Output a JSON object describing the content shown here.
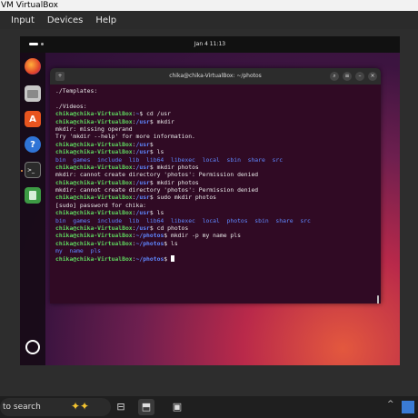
{
  "host": {
    "title": "VM VirtualBox",
    "menu": [
      "Input",
      "Devices",
      "Help"
    ]
  },
  "guest": {
    "clock": "Jan 4  11:13",
    "dock": [
      "firefox",
      "files",
      "app-center",
      "help",
      "terminal",
      "trash",
      "show-apps"
    ]
  },
  "terminal": {
    "title": "chika@chika-VirtualBox: ~/photos",
    "lines": [
      {
        "type": "out",
        "text": "./Templates:"
      },
      {
        "type": "out",
        "text": ""
      },
      {
        "type": "out",
        "text": "./Videos:"
      },
      {
        "type": "prompt",
        "path": "~",
        "cmd": " cd /usr"
      },
      {
        "type": "prompt",
        "path": "/usr",
        "cmd": " mkdir"
      },
      {
        "type": "out",
        "text": "mkdir: missing operand"
      },
      {
        "type": "out",
        "text": "Try 'mkdir --help' for more information."
      },
      {
        "type": "prompt",
        "path": "/usr",
        "cmd": ""
      },
      {
        "type": "prompt",
        "path": "/usr",
        "cmd": " ls"
      },
      {
        "type": "dirs",
        "text": "bin  games  include  lib  lib64  libexec  local  sbin  share  src"
      },
      {
        "type": "prompt",
        "path": "/usr",
        "cmd": " mkdir photos"
      },
      {
        "type": "out",
        "text": "mkdir: cannot create directory 'photos': Permission denied"
      },
      {
        "type": "prompt",
        "path": "/usr",
        "cmd": " mkdir photos"
      },
      {
        "type": "out",
        "text": "mkdir: cannot create directory 'photos': Permission denied"
      },
      {
        "type": "prompt",
        "path": "/usr",
        "cmd": " sudo mkdir photos"
      },
      {
        "type": "out",
        "text": "[sudo] password for chika:"
      },
      {
        "type": "prompt",
        "path": "/usr",
        "cmd": " ls"
      },
      {
        "type": "dirs",
        "text": "bin  games  include  lib  lib64  libexec  local  photos  sbin  share  src"
      },
      {
        "type": "prompt",
        "path": "/usr",
        "cmd": " cd photos"
      },
      {
        "type": "prompt",
        "path": "~/photos",
        "cmd": " mkdir -p my name pls"
      },
      {
        "type": "prompt",
        "path": "~/photos",
        "cmd": " ls"
      },
      {
        "type": "dirs",
        "text": "my  name  pls"
      },
      {
        "type": "prompt",
        "path": "~/photos",
        "cmd": " ",
        "cursor": true
      }
    ],
    "prompt_user": "chika@chika-VirtualBox",
    "colors": {
      "user": "#5fd75f",
      "path": "#5f87ff",
      "bg": "#300a24"
    }
  },
  "taskbar": {
    "search_label": "to search"
  }
}
